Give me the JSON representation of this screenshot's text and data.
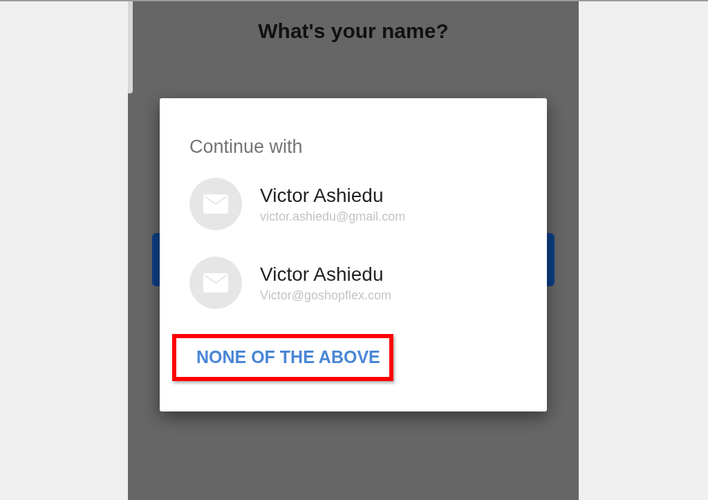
{
  "screen": {
    "title": "What's your name?"
  },
  "dialog": {
    "title": "Continue with",
    "accounts": [
      {
        "name": "Victor Ashiedu",
        "email": "victor.ashiedu@gmail.com"
      },
      {
        "name": "Victor Ashiedu",
        "email": "Victor@goshopflex.com"
      }
    ],
    "button": {
      "label": "NONE OF THE ABOVE",
      "highlighted": true
    }
  }
}
